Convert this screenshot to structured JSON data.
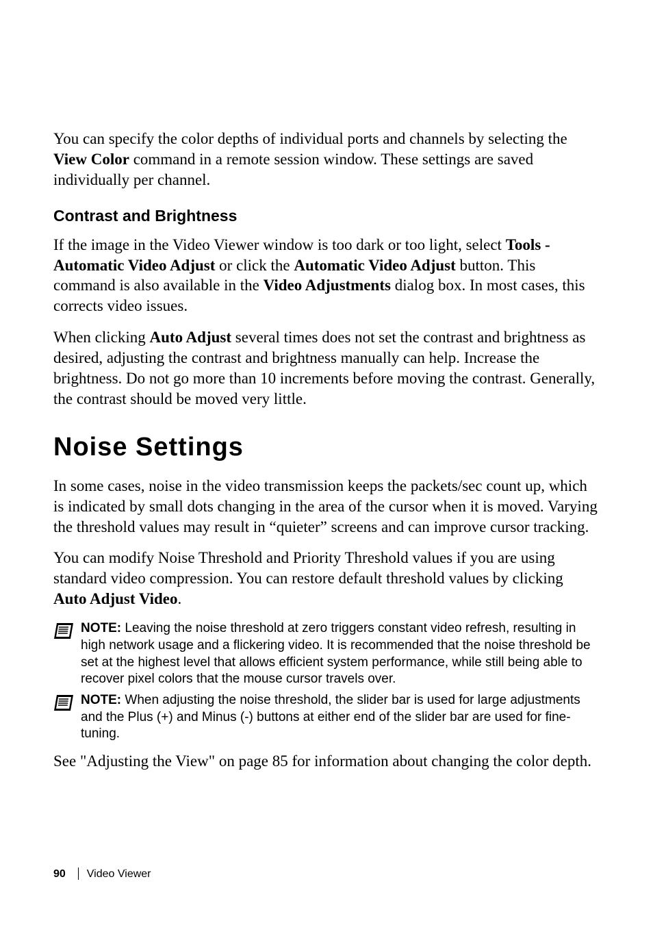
{
  "para1_a": "You can specify the color depths of individual ports and channels by selecting the ",
  "para1_b": "View Color",
  "para1_c": " command in a remote session window. These settings are saved individually per channel.",
  "h3_contrast": "Contrast and Brightness",
  "para2_a": "If the image in the Video Viewer window is too dark or too light, select ",
  "para2_b": "Tools - Automatic Video Adjust",
  "para2_c": " or click the ",
  "para2_d": "Automatic Video Adjust",
  "para2_e": " button. This command is also available in the ",
  "para2_f": "Video Adjustments",
  "para2_g": " dialog box. In most cases, this corrects video issues.",
  "para3_a": "When clicking ",
  "para3_b": "Auto Adjust",
  "para3_c": " several times does not set the contrast and brightness as desired, adjusting the contrast and brightness manually can help. Increase the brightness. Do not go more than 10 increments before moving the contrast. Generally, the contrast should be moved very little.",
  "h1_noise": "Noise Settings",
  "para4": "In some cases, noise in the video transmission keeps the packets/sec count up, which is indicated by small dots changing in the area of the cursor when it is moved. Varying the threshold values may result in “quieter” screens and can improve cursor tracking.",
  "para5_a": "You can modify Noise Threshold and Priority Threshold values if you are using standard video compression. You can restore default threshold values by clicking ",
  "para5_b": "Auto Adjust Video",
  "para5_c": ".",
  "note_label": "NOTE:",
  "note1_text": " Leaving the noise threshold at zero triggers constant video refresh, resulting in high network usage and a flickering video. It is recommended that the noise threshold be set at the highest level that allows efficient system performance, while still being able to recover pixel colors that the mouse cursor travels over.",
  "note2_text": " When adjusting the noise threshold, the slider bar is used for large adjustments and the Plus (+) and Minus (-) buttons at either end of the slider bar are used for fine-tuning.",
  "para6": "See \"Adjusting the View\" on page 85 for information about changing the color depth.",
  "footer_page": "90",
  "footer_section": "Video Viewer"
}
